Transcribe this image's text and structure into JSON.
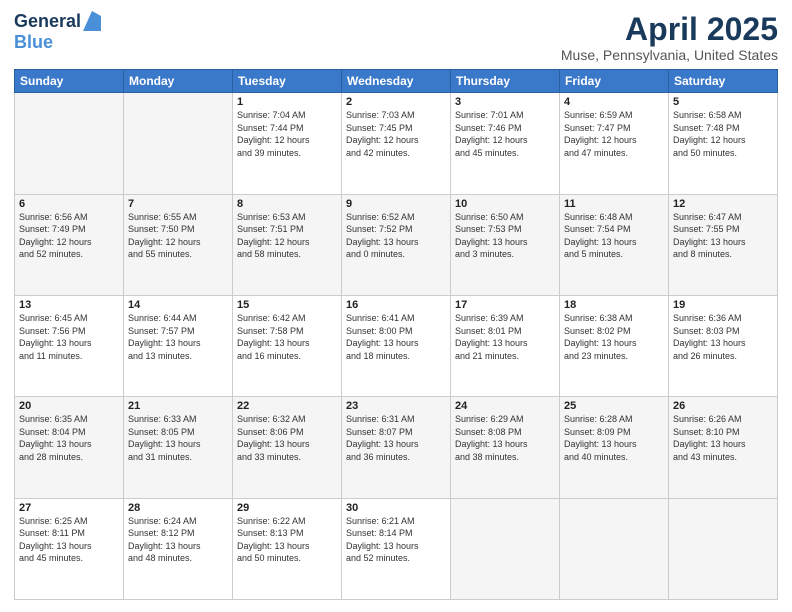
{
  "header": {
    "logo_line1": "General",
    "logo_line2": "Blue",
    "month": "April 2025",
    "location": "Muse, Pennsylvania, United States"
  },
  "days_of_week": [
    "Sunday",
    "Monday",
    "Tuesday",
    "Wednesday",
    "Thursday",
    "Friday",
    "Saturday"
  ],
  "weeks": [
    [
      {
        "num": "",
        "info": ""
      },
      {
        "num": "",
        "info": ""
      },
      {
        "num": "1",
        "info": "Sunrise: 7:04 AM\nSunset: 7:44 PM\nDaylight: 12 hours\nand 39 minutes."
      },
      {
        "num": "2",
        "info": "Sunrise: 7:03 AM\nSunset: 7:45 PM\nDaylight: 12 hours\nand 42 minutes."
      },
      {
        "num": "3",
        "info": "Sunrise: 7:01 AM\nSunset: 7:46 PM\nDaylight: 12 hours\nand 45 minutes."
      },
      {
        "num": "4",
        "info": "Sunrise: 6:59 AM\nSunset: 7:47 PM\nDaylight: 12 hours\nand 47 minutes."
      },
      {
        "num": "5",
        "info": "Sunrise: 6:58 AM\nSunset: 7:48 PM\nDaylight: 12 hours\nand 50 minutes."
      }
    ],
    [
      {
        "num": "6",
        "info": "Sunrise: 6:56 AM\nSunset: 7:49 PM\nDaylight: 12 hours\nand 52 minutes."
      },
      {
        "num": "7",
        "info": "Sunrise: 6:55 AM\nSunset: 7:50 PM\nDaylight: 12 hours\nand 55 minutes."
      },
      {
        "num": "8",
        "info": "Sunrise: 6:53 AM\nSunset: 7:51 PM\nDaylight: 12 hours\nand 58 minutes."
      },
      {
        "num": "9",
        "info": "Sunrise: 6:52 AM\nSunset: 7:52 PM\nDaylight: 13 hours\nand 0 minutes."
      },
      {
        "num": "10",
        "info": "Sunrise: 6:50 AM\nSunset: 7:53 PM\nDaylight: 13 hours\nand 3 minutes."
      },
      {
        "num": "11",
        "info": "Sunrise: 6:48 AM\nSunset: 7:54 PM\nDaylight: 13 hours\nand 5 minutes."
      },
      {
        "num": "12",
        "info": "Sunrise: 6:47 AM\nSunset: 7:55 PM\nDaylight: 13 hours\nand 8 minutes."
      }
    ],
    [
      {
        "num": "13",
        "info": "Sunrise: 6:45 AM\nSunset: 7:56 PM\nDaylight: 13 hours\nand 11 minutes."
      },
      {
        "num": "14",
        "info": "Sunrise: 6:44 AM\nSunset: 7:57 PM\nDaylight: 13 hours\nand 13 minutes."
      },
      {
        "num": "15",
        "info": "Sunrise: 6:42 AM\nSunset: 7:58 PM\nDaylight: 13 hours\nand 16 minutes."
      },
      {
        "num": "16",
        "info": "Sunrise: 6:41 AM\nSunset: 8:00 PM\nDaylight: 13 hours\nand 18 minutes."
      },
      {
        "num": "17",
        "info": "Sunrise: 6:39 AM\nSunset: 8:01 PM\nDaylight: 13 hours\nand 21 minutes."
      },
      {
        "num": "18",
        "info": "Sunrise: 6:38 AM\nSunset: 8:02 PM\nDaylight: 13 hours\nand 23 minutes."
      },
      {
        "num": "19",
        "info": "Sunrise: 6:36 AM\nSunset: 8:03 PM\nDaylight: 13 hours\nand 26 minutes."
      }
    ],
    [
      {
        "num": "20",
        "info": "Sunrise: 6:35 AM\nSunset: 8:04 PM\nDaylight: 13 hours\nand 28 minutes."
      },
      {
        "num": "21",
        "info": "Sunrise: 6:33 AM\nSunset: 8:05 PM\nDaylight: 13 hours\nand 31 minutes."
      },
      {
        "num": "22",
        "info": "Sunrise: 6:32 AM\nSunset: 8:06 PM\nDaylight: 13 hours\nand 33 minutes."
      },
      {
        "num": "23",
        "info": "Sunrise: 6:31 AM\nSunset: 8:07 PM\nDaylight: 13 hours\nand 36 minutes."
      },
      {
        "num": "24",
        "info": "Sunrise: 6:29 AM\nSunset: 8:08 PM\nDaylight: 13 hours\nand 38 minutes."
      },
      {
        "num": "25",
        "info": "Sunrise: 6:28 AM\nSunset: 8:09 PM\nDaylight: 13 hours\nand 40 minutes."
      },
      {
        "num": "26",
        "info": "Sunrise: 6:26 AM\nSunset: 8:10 PM\nDaylight: 13 hours\nand 43 minutes."
      }
    ],
    [
      {
        "num": "27",
        "info": "Sunrise: 6:25 AM\nSunset: 8:11 PM\nDaylight: 13 hours\nand 45 minutes."
      },
      {
        "num": "28",
        "info": "Sunrise: 6:24 AM\nSunset: 8:12 PM\nDaylight: 13 hours\nand 48 minutes."
      },
      {
        "num": "29",
        "info": "Sunrise: 6:22 AM\nSunset: 8:13 PM\nDaylight: 13 hours\nand 50 minutes."
      },
      {
        "num": "30",
        "info": "Sunrise: 6:21 AM\nSunset: 8:14 PM\nDaylight: 13 hours\nand 52 minutes."
      },
      {
        "num": "",
        "info": ""
      },
      {
        "num": "",
        "info": ""
      },
      {
        "num": "",
        "info": ""
      }
    ]
  ]
}
